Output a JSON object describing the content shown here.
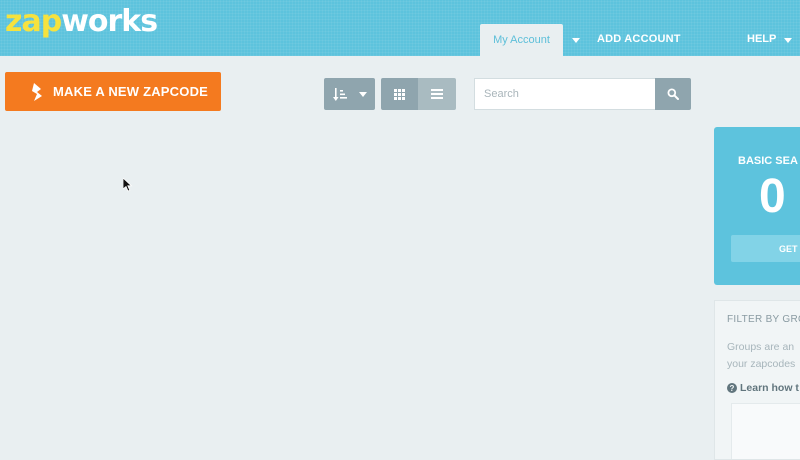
{
  "header": {
    "logo_part1": "zap",
    "logo_part2": "works",
    "tab_my_account": "My Account",
    "add_account": "ADD ACCOUNT",
    "help": "HELP"
  },
  "toolbar": {
    "make_button_label": "MAKE A NEW ZAPCODE",
    "search_placeholder": "Search",
    "search_value": ""
  },
  "plan": {
    "title": "BASIC SEA",
    "count": "0",
    "button_label": "GET"
  },
  "filter": {
    "title": "FILTER BY GRO",
    "desc_line1": "Groups are an",
    "desc_line2": "your zapcodes",
    "link_label": "Learn how t"
  },
  "icons": {
    "make": "zapcode-icon",
    "sort": "sort-icon",
    "grid": "grid-view-icon",
    "list": "list-view-icon",
    "search": "search-icon",
    "help": "question-circle-icon"
  },
  "colors": {
    "header": "#5dc3dd",
    "accent": "#f47a1f",
    "logo_yellow": "#f6e23e",
    "toolbar_button": "#8fa5ae"
  }
}
